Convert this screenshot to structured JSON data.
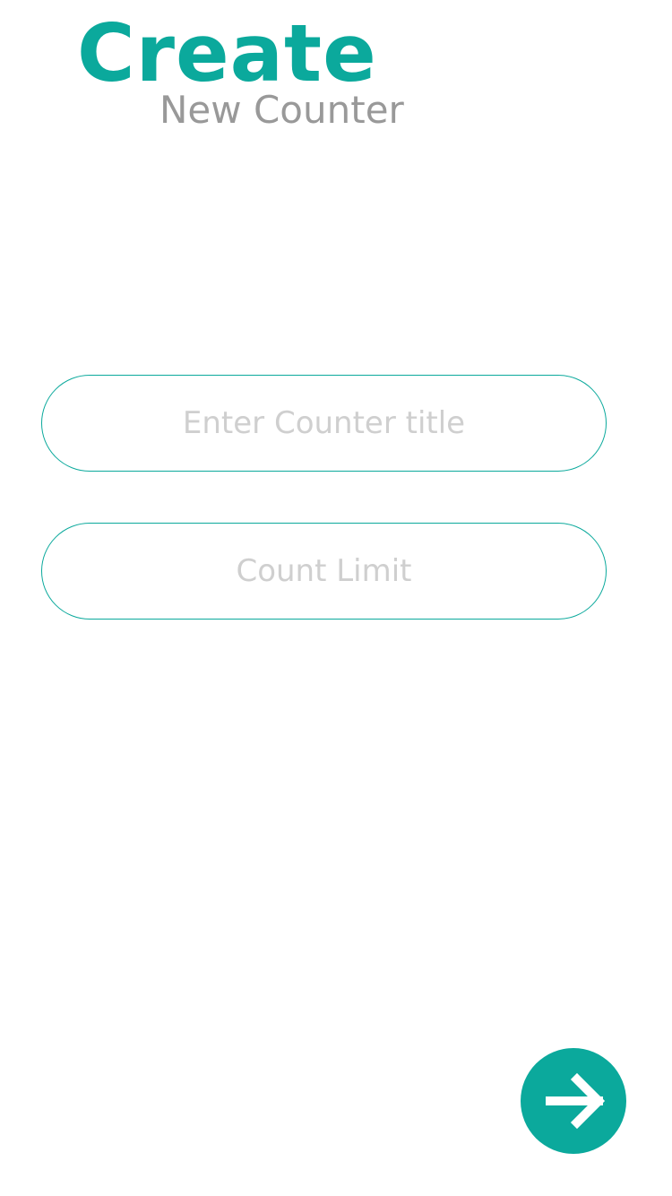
{
  "header": {
    "title": "Create",
    "subtitle": "New Counter"
  },
  "form": {
    "title_field": {
      "value": "",
      "placeholder": "Enter Counter title"
    },
    "limit_field": {
      "value": "",
      "placeholder": "Count Limit"
    }
  },
  "next_button": {
    "icon": "arrow-right-icon"
  },
  "colors": {
    "accent": "#0ba99c",
    "subtitle": "#999999",
    "placeholder": "#cfcfcf"
  }
}
